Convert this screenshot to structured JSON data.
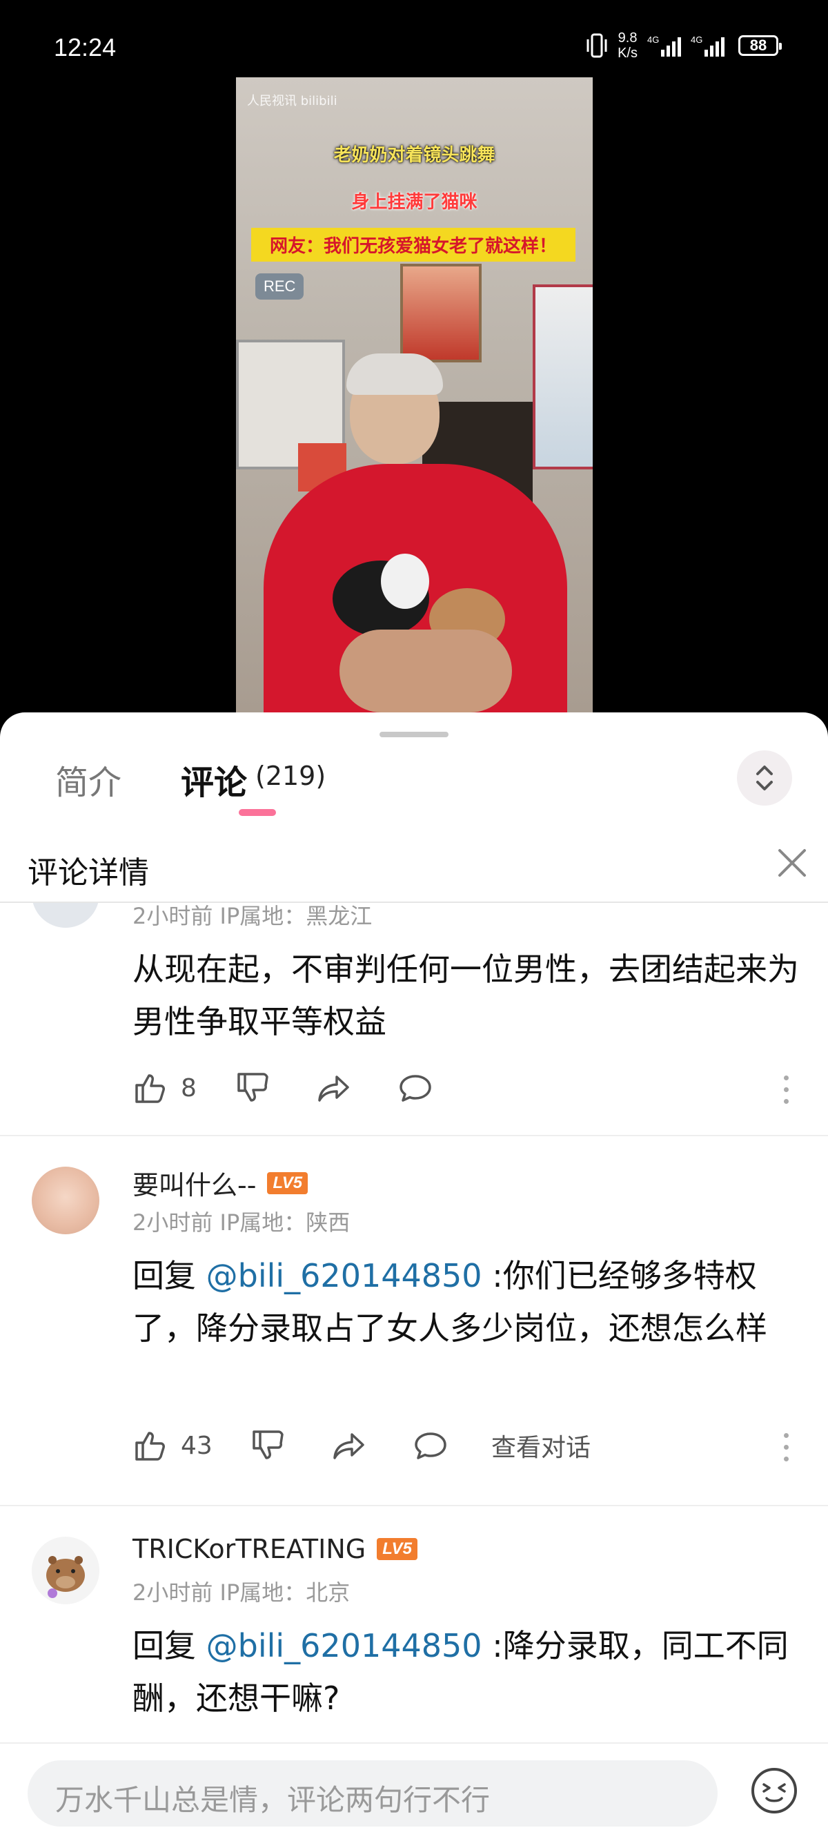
{
  "status_bar": {
    "time": "12:24",
    "net_speed_value": "9.8",
    "net_speed_unit": "K/s",
    "signal1_tag": "4G",
    "signal2_tag": "4G",
    "battery": "88"
  },
  "video": {
    "watermark": "人民视讯 bilibili",
    "caption_line1": "老奶奶对着镜头跳舞",
    "caption_line2": "身上挂满了猫咪",
    "caption_line3": "网友：我们无孩爱猫女老了就这样！",
    "rec_label": "REC"
  },
  "tabs": {
    "intro": "简介",
    "comments": "评论",
    "comments_count": "(219)"
  },
  "subheader": {
    "title": "评论详情"
  },
  "comments": [
    {
      "meta": "2小时前 IP属地：黑龙江",
      "content": "从现在起，不审判任何一位男性，去团结起来为男性争取平等权益",
      "likes": "8"
    },
    {
      "username": "要叫什么--",
      "level": "LV5",
      "meta": "2小时前 IP属地：陕西",
      "reply_prefix": "回复 ",
      "mention": "@bili_620144850",
      "content": " :你们已经够多特权了，降分录取占了女人多少岗位，还想怎么样",
      "likes": "43",
      "view_conversation": "查看对话"
    },
    {
      "username": "TRICKorTREATING",
      "level": "LV5",
      "meta": "2小时前 IP属地：北京",
      "reply_prefix": "回复 ",
      "mention": "@bili_620144850",
      "content": " :降分录取，同工不同酬，还想干嘛?"
    }
  ],
  "input": {
    "placeholder": "万水千山总是情，评论两句行不行"
  },
  "colors": {
    "accent_pink": "#fb7299",
    "level_orange": "#f27d2e",
    "mention_blue": "#1f6fa5"
  }
}
